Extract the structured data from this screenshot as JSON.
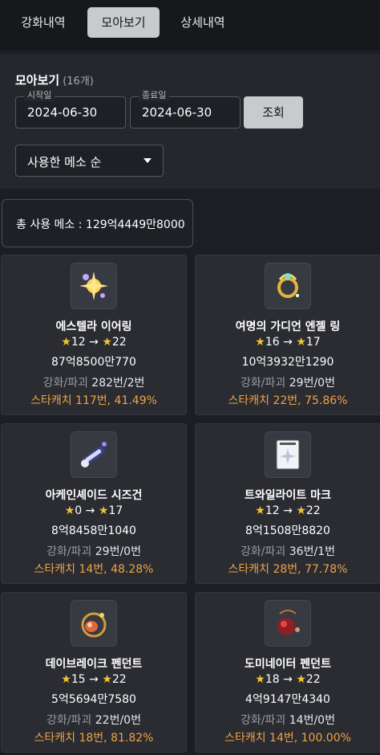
{
  "tabs": [
    {
      "label": "강화내역",
      "active": false
    },
    {
      "label": "모아보기",
      "active": true
    },
    {
      "label": "상세내역",
      "active": false
    }
  ],
  "summary": {
    "title": "모아보기",
    "count": "(16개)",
    "start_label": "시작일",
    "start_value": "2024-06-30",
    "end_label": "종료일",
    "end_value": "2024-06-30",
    "search_label": "조회",
    "sort_value": "사용한 메소 순"
  },
  "total": {
    "text": "총 사용 메소 : 129억4449만8000"
  },
  "items": [
    {
      "name": "에스텔라 이어링",
      "from": "12",
      "to": "22",
      "meso": "87억8500만770",
      "enh_label": "강화/파괴",
      "enh_value": "282번/2번",
      "catch": "스타캐치 117번, 41.49%",
      "icon": "earring-icon"
    },
    {
      "name": "여명의 가디언 엔젤 링",
      "from": "16",
      "to": "17",
      "meso": "10억3932만1290",
      "enh_label": "강화/파괴",
      "enh_value": "29번/0번",
      "catch": "스타캐치 22번, 75.86%",
      "icon": "ring-icon"
    },
    {
      "name": "아케인셰이드 시즈건",
      "from": "0",
      "to": "17",
      "meso": "8억8458만1040",
      "enh_label": "강화/파괴",
      "enh_value": "29번/0번",
      "catch": "스타캐치 14번, 48.28%",
      "icon": "gun-icon"
    },
    {
      "name": "트와일라이트 마크",
      "from": "12",
      "to": "22",
      "meso": "8억1508만8820",
      "enh_label": "강화/파괴",
      "enh_value": "36번/1번",
      "catch": "스타캐치 28번, 77.78%",
      "icon": "mark-icon"
    },
    {
      "name": "데이브레이크 펜던트",
      "from": "15",
      "to": "22",
      "meso": "5억5694만7580",
      "enh_label": "강화/파괴",
      "enh_value": "22번/0번",
      "catch": "스타캐치 18번, 81.82%",
      "icon": "pendant-icon"
    },
    {
      "name": "도미네이터 펜던트",
      "from": "18",
      "to": "22",
      "meso": "4억9147만4340",
      "enh_label": "강화/파괴",
      "enh_value": "14번/0번",
      "catch": "스타캐치 14번, 100.00%",
      "icon": "red-pendant-icon"
    }
  ]
}
